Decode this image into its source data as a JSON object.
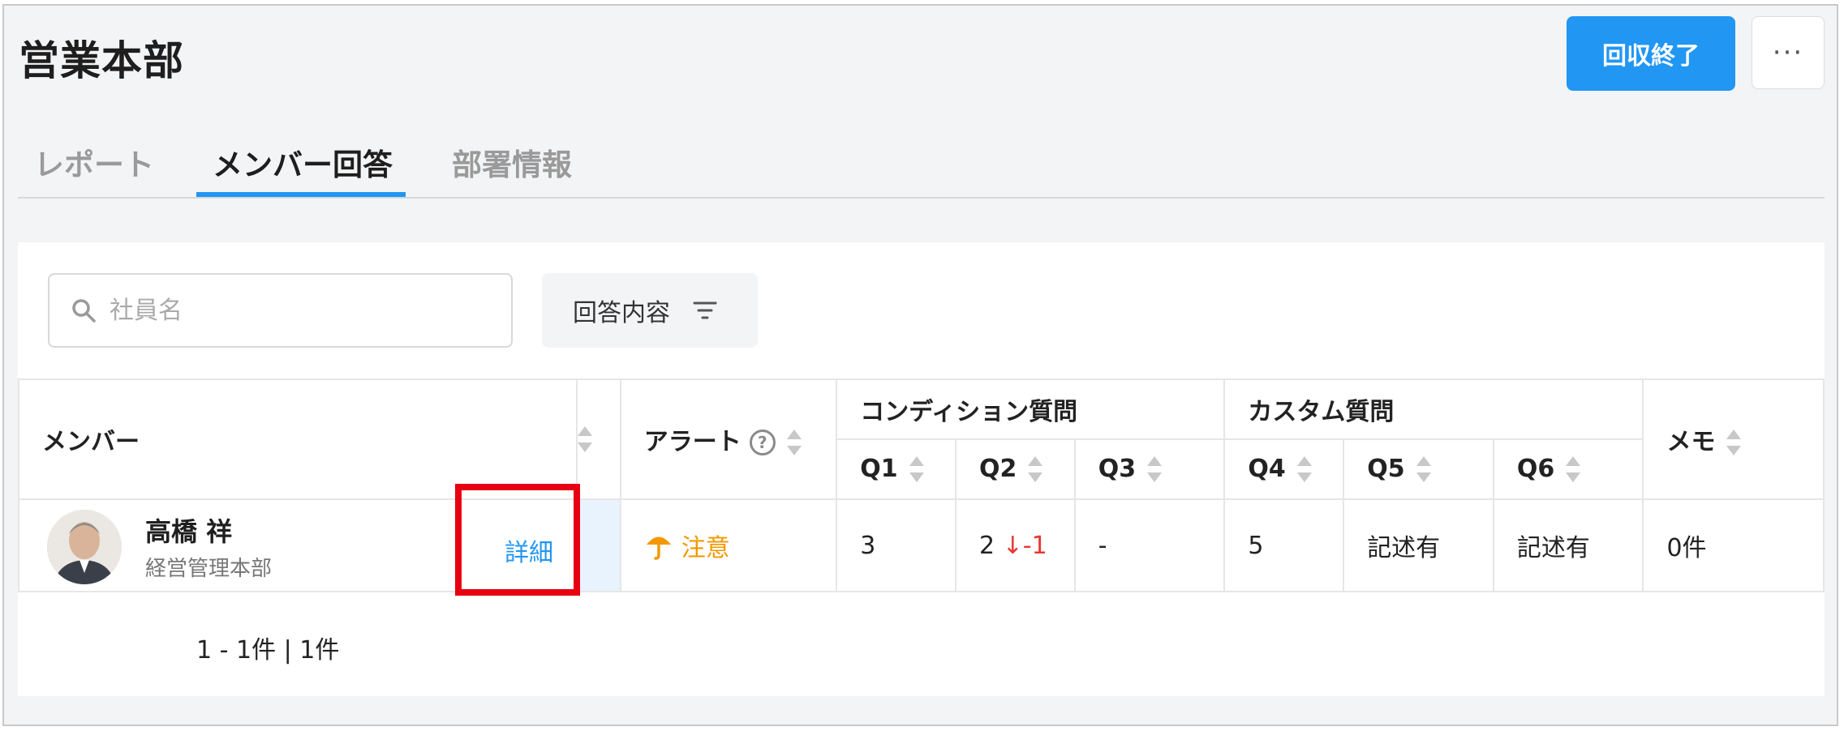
{
  "header": {
    "title": "営業本部",
    "primary_button": "回収終了",
    "more_button": "···"
  },
  "tabs": [
    {
      "label": "レポート",
      "active": false
    },
    {
      "label": "メンバー回答",
      "active": true
    },
    {
      "label": "部署情報",
      "active": false
    }
  ],
  "filters": {
    "search_placeholder": "社員名",
    "filter_button": "回答内容"
  },
  "table": {
    "headers": {
      "member": "メンバー",
      "alert": "アラート",
      "alert_help": "?",
      "condition_group": "コンディション質問",
      "custom_group": "カスタム質問",
      "memo": "メモ",
      "q1": "Q1",
      "q2": "Q2",
      "q3": "Q3",
      "q4": "Q4",
      "q5": "Q5",
      "q6": "Q6"
    },
    "rows": [
      {
        "name": "高橋 祥",
        "department": "経営管理本部",
        "detail": "詳細",
        "alert": "注意",
        "q1": "3",
        "q2": "2",
        "q2_change": "↓-1",
        "q3": "-",
        "q4": "5",
        "q5": "記述有",
        "q6": "記述有",
        "memo": "0件"
      }
    ]
  },
  "pagination": "1 - 1件 | 1件",
  "colors": {
    "accent": "#2196f3",
    "alert": "#f39800",
    "negative": "#e53935",
    "highlight": "#e60012"
  }
}
